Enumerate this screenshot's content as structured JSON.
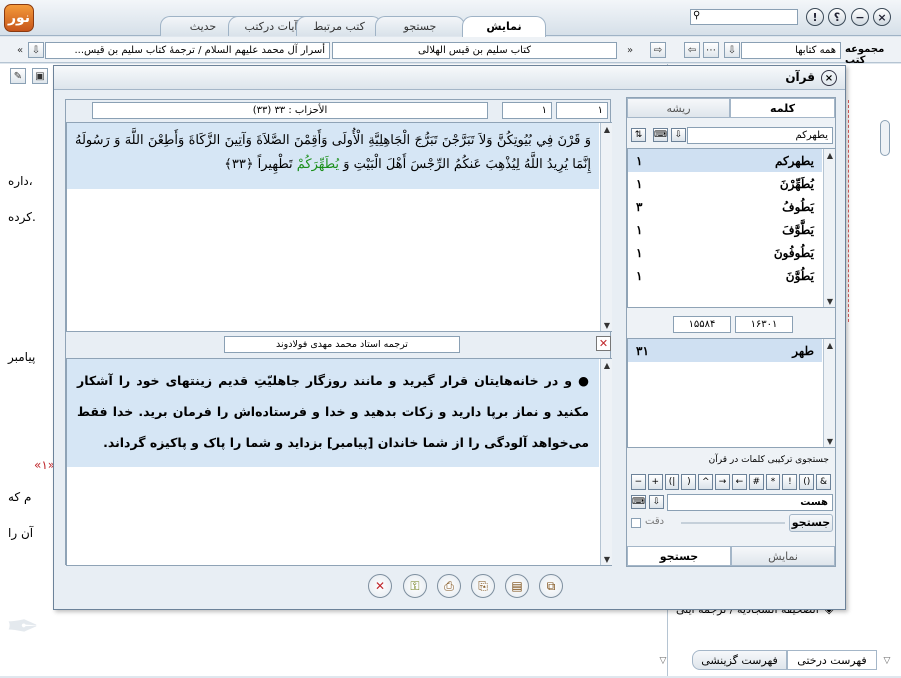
{
  "top": {
    "tabs": [
      "نمایش",
      "جستجو",
      "کتب مرتبط",
      "آیات درکتب",
      "حدیث"
    ],
    "active_tab": 0,
    "logo": "نور",
    "buttons": [
      "×",
      "−",
      "؟",
      "!"
    ]
  },
  "bar2": {
    "collection_label": "مجموعه کتب",
    "collection_value": "همه کتابها",
    "book_title": "کتاب سلیم بن قیس الهلالی",
    "breadcrumb": "أسرار آل محمد علیهم السلام / ترجمهٔ کتاب سلیم بن قیس..."
  },
  "background_fragments": [
    "داره،",
    "کرده.",
    "پیامبر",
    "«۱»",
    "م که",
    "آن را"
  ],
  "right_panel": {
    "list": [
      "الصحیفة السجادیة / ترجمه ایتی"
    ],
    "tabs": [
      "فهرست درختی",
      "فهرست گزینشی"
    ]
  },
  "dialog": {
    "title": "قرآن",
    "verse_num": "۱",
    "page_num": "۱",
    "surah": "(۳۳) الأحزاب : ۳۳",
    "verse_text_a": "وَ قَرْنَ فِي بُيُوتِكُنَّ وَلاَ تَبَرَّجْنَ تَبَرُّجَ الْجَاهِلِيَّةِ الْأُولَى وَأَقِمْنَ الصَّلاَةَ وَآتِينَ الزَّكَاةَ وَأَطِعْنَ اللَّهَ وَ رَسُولَهُ إِنَّمَا يُرِيدُ اللَّهُ لِيُذْهِبَ عَنكُمُ الرِّجْسَ أَهْلَ الْبَيْتِ وَ",
    "verse_highlight": "يُطَهِّرَكُمْ",
    "verse_text_b": "تَطْهِيراً ﴿۳۳﴾",
    "translator": "ترجمه استاد محمد مهدی فولادوند",
    "translation": "● و در خانه‌هایتان قرار گیرید و مانند روزگار جاهلیّتِ قدیم زینتهای خود را آشکار مکنید و نماز برپا دارید و زکات بدهید و خدا و فرستاده‌اش را فرمان برید. خدا فقط می‌خواهد آلودگی را از شما خاندان [پیامبر] بزداید و شما را پاک و پاکیزه گرداند.",
    "side": {
      "tabs": [
        "کلمه",
        "ریشه"
      ],
      "active_tab": 0,
      "search_value": "یطهرکم",
      "words": [
        {
          "word": "یطهرکم",
          "count": "۱"
        },
        {
          "word": "يُطَهِّرْنَ",
          "count": "۱"
        },
        {
          "word": "يَطُوفُ",
          "count": "۳"
        },
        {
          "word": "يَطَّوَّفَ",
          "count": "۱"
        },
        {
          "word": "يَطُوفُونَ",
          "count": "۱"
        },
        {
          "word": "يَطُوَّنَ",
          "count": "۱"
        }
      ],
      "counter_a": "۱۶۳۰۱",
      "counter_b": "۱۵۵۸۴",
      "roots": [
        {
          "word": "طهر",
          "count": "۳۱"
        }
      ],
      "combo_title": "جستجوی ترکیبی کلمات در قرآن",
      "ops": [
        "&",
        "()",
        "!",
        "*",
        "#",
        "←",
        "→",
        "^",
        "(",
        "|)",
        "+",
        "−",
        "="
      ],
      "combo_value": "هست",
      "search_btn": "جستجو",
      "precision": "دقت",
      "bottom_tabs": [
        "نمایش",
        "جستجو"
      ]
    }
  }
}
